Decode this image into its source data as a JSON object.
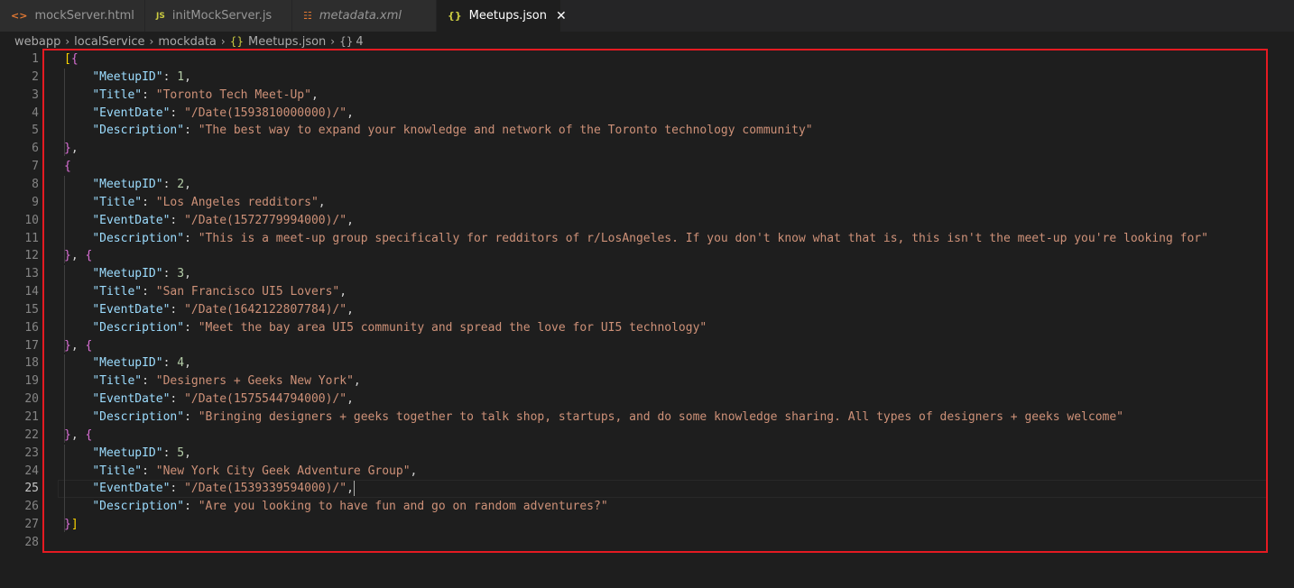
{
  "tabs": [
    {
      "label": "mockServer.html",
      "icon": "html-icon",
      "glyph": "<>",
      "italic": false,
      "active": false
    },
    {
      "label": "initMockServer.js",
      "icon": "js-icon",
      "glyph": "JS",
      "italic": false,
      "active": false
    },
    {
      "label": "metadata.xml",
      "icon": "rss-icon",
      "glyph": "☷",
      "italic": true,
      "active": false
    },
    {
      "label": "Meetups.json",
      "icon": "json-icon",
      "glyph": "{}",
      "italic": false,
      "active": true,
      "close": "✕"
    }
  ],
  "breadcrumb": {
    "items": [
      "webapp",
      "localService",
      "mockdata"
    ],
    "file_icon": "{}",
    "file": "Meetups.json",
    "symbol_icon": "{}",
    "symbol": "4"
  },
  "editor": {
    "current_line": 25,
    "lines": [
      {
        "n": "1",
        "text": "[{"
      },
      {
        "n": "2",
        "text": "    \"MeetupID\": 1,"
      },
      {
        "n": "3",
        "text": "    \"Title\": \"Toronto Tech Meet-Up\","
      },
      {
        "n": "4",
        "text": "    \"EventDate\": \"/Date(1593810000000)/\","
      },
      {
        "n": "5",
        "text": "    \"Description\": \"The best way to expand your knowledge and network of the Toronto technology community\""
      },
      {
        "n": "6",
        "text": "},"
      },
      {
        "n": "7",
        "text": "{"
      },
      {
        "n": "8",
        "text": "    \"MeetupID\": 2,"
      },
      {
        "n": "9",
        "text": "    \"Title\": \"Los Angeles redditors\","
      },
      {
        "n": "10",
        "text": "    \"EventDate\": \"/Date(1572779994000)/\","
      },
      {
        "n": "11",
        "text": "    \"Description\": \"This is a meet-up group specifically for redditors of r/LosAngeles. If you don't know what that is, this isn't the meet-up you're looking for\""
      },
      {
        "n": "12",
        "text": "}, {"
      },
      {
        "n": "13",
        "text": "    \"MeetupID\": 3,"
      },
      {
        "n": "14",
        "text": "    \"Title\": \"San Francisco UI5 Lovers\","
      },
      {
        "n": "15",
        "text": "    \"EventDate\": \"/Date(1642122807784)/\","
      },
      {
        "n": "16",
        "text": "    \"Description\": \"Meet the bay area UI5 community and spread the love for UI5 technology\""
      },
      {
        "n": "17",
        "text": "}, {"
      },
      {
        "n": "18",
        "text": "    \"MeetupID\": 4,"
      },
      {
        "n": "19",
        "text": "    \"Title\": \"Designers + Geeks New York\","
      },
      {
        "n": "20",
        "text": "    \"EventDate\": \"/Date(1575544794000)/\","
      },
      {
        "n": "21",
        "text": "    \"Description\": \"Bringing designers + geeks together to talk shop, startups, and do some knowledge sharing. All types of designers + geeks welcome\""
      },
      {
        "n": "22",
        "text": "}, {"
      },
      {
        "n": "23",
        "text": "    \"MeetupID\": 5,"
      },
      {
        "n": "24",
        "text": "    \"Title\": \"New York City Geek Adventure Group\","
      },
      {
        "n": "25",
        "text": "    \"EventDate\": \"/Date(1539339594000)/\","
      },
      {
        "n": "26",
        "text": "    \"Description\": \"Are you looking to have fun and go on random adventures?\""
      },
      {
        "n": "27",
        "text": "}]"
      },
      {
        "n": "28",
        "text": ""
      }
    ]
  },
  "colors": {
    "highlight_border": "#e51a22",
    "key": "#9cdcfe",
    "string": "#ce9178",
    "number": "#b5cea8",
    "bracket_outer": "#ffd700",
    "bracket_inner": "#da70d6"
  }
}
